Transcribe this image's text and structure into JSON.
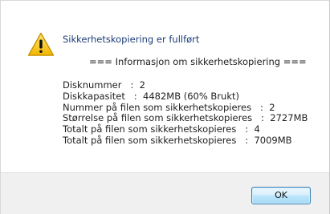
{
  "dialog": {
    "icon": "warning-icon",
    "message": "Sikkerhetskopiering er fullført",
    "info_header": "=== Informasjon om sikkerhetskopiering ===",
    "info_rows": [
      {
        "label": "Disknummer   :",
        "value": "2"
      },
      {
        "label": "Diskkapasitet   :",
        "value": "4482MB (60% Brukt)"
      },
      {
        "label": "Nummer på filen som sikkerhetskopieres   :",
        "value": "2"
      },
      {
        "label": "Størrelse på filen som sikkerhetskopieres   :",
        "value": "2727MB"
      },
      {
        "label": "Totalt på filen som sikkerhetskopieres   :",
        "value": "4"
      },
      {
        "label": "Totalt på filen som sikkerhetskopieres   :",
        "value": "7009MB"
      }
    ],
    "ok_label": "OK",
    "colors": {
      "message_text": "#1e3c78",
      "button_border": "#3c7fb1",
      "footer_bg": "#f0f0f0",
      "warning_fill": "#f5c400"
    }
  }
}
